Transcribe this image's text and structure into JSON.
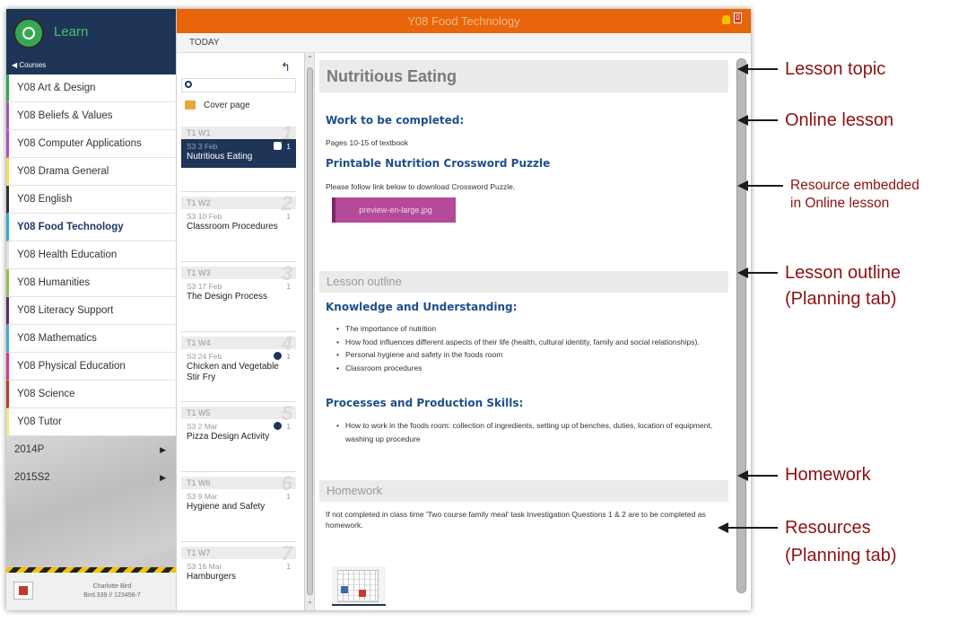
{
  "sidebar": {
    "app_name": "Learn",
    "back_label": "◀ Courses",
    "courses": [
      {
        "label": "Y08 Art & Design",
        "color": "#2fa64a"
      },
      {
        "label": "Y08 Beliefs & Values",
        "color": "#9b59b6"
      },
      {
        "label": "Y08 Computer Applications",
        "color": "#b04ad0"
      },
      {
        "label": "Y08 Drama General",
        "color": "#f3e04a"
      },
      {
        "label": "Y08 English",
        "color": "#333333"
      },
      {
        "label": "Y08 Food Technology",
        "color": "#32a8d8",
        "active": true
      },
      {
        "label": "Y08 Health Education",
        "color": "#e0e0e0"
      },
      {
        "label": "Y08 Humanities",
        "color": "#8bc34a"
      },
      {
        "label": "Y08 Literacy Support",
        "color": "#5a2a6a"
      },
      {
        "label": "Y08 Mathematics",
        "color": "#47a6d8"
      },
      {
        "label": "Y08 Physical Education",
        "color": "#d23a8a"
      },
      {
        "label": "Y08 Science",
        "color": "#c0392b"
      },
      {
        "label": "Y08 Tutor",
        "color": "#f0e68c"
      }
    ],
    "terms": [
      {
        "label": "2014P"
      },
      {
        "label": "2015S2"
      }
    ],
    "user": {
      "name": "Charlotte Bird",
      "id": "Bird.339 // 123456-7"
    }
  },
  "topbar": {
    "course_title": "Y08 Food Technology",
    "notification_count": "0",
    "accent": "#e8650b"
  },
  "today_label": "TODAY",
  "lesson_list": {
    "cover_label": "Cover page",
    "lessons": [
      {
        "week": "T1  W1",
        "num": "1",
        "date": "S3  3 Feb",
        "title": "Nutritious Eating",
        "count": "1",
        "selected": true
      },
      {
        "week": "T1  W2",
        "num": "2",
        "date": "S3  10 Feb",
        "title": "Classroom Procedures",
        "count": "1"
      },
      {
        "week": "T1  W3",
        "num": "3",
        "date": "S3  17 Feb",
        "title": "The Design Process",
        "count": "1"
      },
      {
        "week": "T1  W4",
        "num": "4",
        "date": "S3  24 Feb",
        "title": "Chicken and Vegetable Stir Fry",
        "count": "1",
        "icon": true
      },
      {
        "week": "T1  W5",
        "num": "5",
        "date": "S3  2 Mar",
        "title": "Pizza Design Activity",
        "count": "1",
        "icon": true
      },
      {
        "week": "T1  W6",
        "num": "6",
        "date": "S3  9 Mar",
        "title": "Hygiene and Safety",
        "count": "1"
      },
      {
        "week": "T1  W7",
        "num": "7",
        "date": "S3  16 Mar",
        "title": "Hamburgers",
        "count": "1"
      }
    ]
  },
  "content": {
    "topic": "Nutritious Eating",
    "work_heading": "Work to be completed:",
    "work_text": "Pages 10-15 of textbook",
    "crossword_heading": "Printable Nutrition Crossword Puzzle",
    "crossword_text": "Please follow link below to download Crossword Puzzle.",
    "resource_button": "preview-en-large.jpg",
    "outline_heading": "Lesson outline",
    "knowledge_heading": "Knowledge and Understanding:",
    "knowledge_items": [
      "The importance of nutrition",
      "How food influences different aspects of their life (health, cultural identity, family and social relationships).",
      "Personal hygiene and safety in the foods room",
      "Classroom procedures"
    ],
    "processes_heading": "Processes and Production Skills:",
    "processes_items": [
      "How to work in the foods room: collection of ingredients, setting up of benches, duties, location of equipment, washing up procedure"
    ],
    "homework_heading": "Homework",
    "homework_text": "If not completed in class time 'Two course family meal' task Investigation Questions 1 & 2 are to be completed as homework."
  },
  "annotations": [
    {
      "lines": [
        "Lesson topic"
      ]
    },
    {
      "lines": [
        "Online lesson"
      ]
    },
    {
      "lines": [
        "Resource embedded",
        "in Online lesson"
      ]
    },
    {
      "lines": [
        "Lesson outline",
        "(Planning tab)"
      ]
    },
    {
      "lines": [
        "Homework"
      ]
    },
    {
      "lines": [
        "Resources",
        "(Planning tab)"
      ]
    }
  ]
}
